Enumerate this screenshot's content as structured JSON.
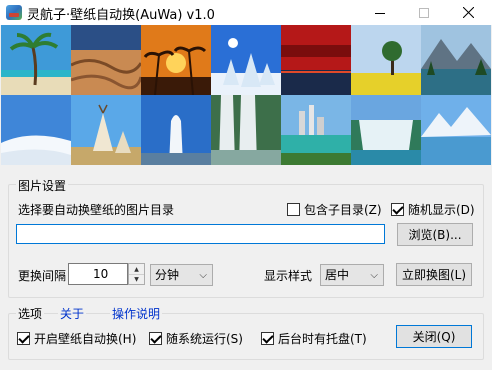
{
  "window": {
    "title": "灵航子·壁纸自动换(AuWa) v1.0",
    "controls": {
      "minimize": "minimize-icon",
      "maximize": "maximize-icon",
      "close": "close-icon"
    }
  },
  "gallery": {
    "rows": 2,
    "columns": 7,
    "thumbnails": [
      "palm-tree-beach",
      "desert-dunes",
      "sunset-palms",
      "snowy-trees-blue-sky",
      "red-sunset-sea",
      "yellow-flower-field-tree",
      "mountain-lake",
      "snow-hills",
      "teepee-tents",
      "waterfall-sky",
      "waterfall-rocks",
      "tropical-city-bay",
      "waterfall-cascade",
      "snowy-mountain-lake"
    ]
  },
  "image_settings": {
    "legend": "图片设置",
    "dir_label": "选择要自动换壁纸的图片目录",
    "include_subdirs_label": "包含子目录(Z)",
    "include_subdirs_checked": false,
    "random_label": "随机显示(D)",
    "random_checked": true,
    "dir_value": "",
    "browse_label": "浏览(B)...",
    "interval_label": "更换间隔",
    "interval_value": "10",
    "interval_unit": "分钟",
    "style_label": "显示样式",
    "style_value": "居中",
    "change_now_label": "立即换图(L)"
  },
  "options": {
    "legend": "选项",
    "about_link": "关于",
    "help_link": "操作说明",
    "auto_change_label": "开启壁纸自动换(H)",
    "auto_change_checked": true,
    "startup_label": "随系统运行(S)",
    "startup_checked": true,
    "tray_label": "后台时有托盘(T)",
    "tray_checked": true,
    "close_label": "关闭(Q)"
  }
}
